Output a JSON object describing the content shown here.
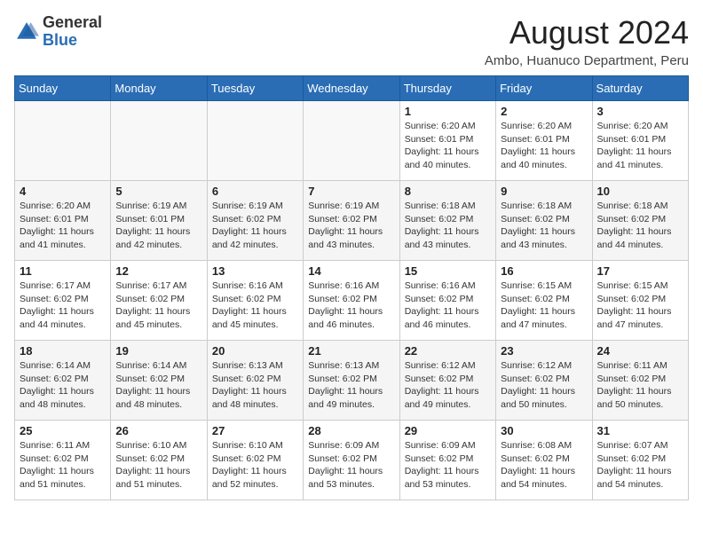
{
  "header": {
    "logo_general": "General",
    "logo_blue": "Blue",
    "month_title": "August 2024",
    "location": "Ambo, Huanuco Department, Peru"
  },
  "weekdays": [
    "Sunday",
    "Monday",
    "Tuesday",
    "Wednesday",
    "Thursday",
    "Friday",
    "Saturday"
  ],
  "weeks": [
    [
      {
        "day": "",
        "info": ""
      },
      {
        "day": "",
        "info": ""
      },
      {
        "day": "",
        "info": ""
      },
      {
        "day": "",
        "info": ""
      },
      {
        "day": "1",
        "info": "Sunrise: 6:20 AM\nSunset: 6:01 PM\nDaylight: 11 hours\nand 40 minutes."
      },
      {
        "day": "2",
        "info": "Sunrise: 6:20 AM\nSunset: 6:01 PM\nDaylight: 11 hours\nand 40 minutes."
      },
      {
        "day": "3",
        "info": "Sunrise: 6:20 AM\nSunset: 6:01 PM\nDaylight: 11 hours\nand 41 minutes."
      }
    ],
    [
      {
        "day": "4",
        "info": "Sunrise: 6:20 AM\nSunset: 6:01 PM\nDaylight: 11 hours\nand 41 minutes."
      },
      {
        "day": "5",
        "info": "Sunrise: 6:19 AM\nSunset: 6:01 PM\nDaylight: 11 hours\nand 42 minutes."
      },
      {
        "day": "6",
        "info": "Sunrise: 6:19 AM\nSunset: 6:02 PM\nDaylight: 11 hours\nand 42 minutes."
      },
      {
        "day": "7",
        "info": "Sunrise: 6:19 AM\nSunset: 6:02 PM\nDaylight: 11 hours\nand 43 minutes."
      },
      {
        "day": "8",
        "info": "Sunrise: 6:18 AM\nSunset: 6:02 PM\nDaylight: 11 hours\nand 43 minutes."
      },
      {
        "day": "9",
        "info": "Sunrise: 6:18 AM\nSunset: 6:02 PM\nDaylight: 11 hours\nand 43 minutes."
      },
      {
        "day": "10",
        "info": "Sunrise: 6:18 AM\nSunset: 6:02 PM\nDaylight: 11 hours\nand 44 minutes."
      }
    ],
    [
      {
        "day": "11",
        "info": "Sunrise: 6:17 AM\nSunset: 6:02 PM\nDaylight: 11 hours\nand 44 minutes."
      },
      {
        "day": "12",
        "info": "Sunrise: 6:17 AM\nSunset: 6:02 PM\nDaylight: 11 hours\nand 45 minutes."
      },
      {
        "day": "13",
        "info": "Sunrise: 6:16 AM\nSunset: 6:02 PM\nDaylight: 11 hours\nand 45 minutes."
      },
      {
        "day": "14",
        "info": "Sunrise: 6:16 AM\nSunset: 6:02 PM\nDaylight: 11 hours\nand 46 minutes."
      },
      {
        "day": "15",
        "info": "Sunrise: 6:16 AM\nSunset: 6:02 PM\nDaylight: 11 hours\nand 46 minutes."
      },
      {
        "day": "16",
        "info": "Sunrise: 6:15 AM\nSunset: 6:02 PM\nDaylight: 11 hours\nand 47 minutes."
      },
      {
        "day": "17",
        "info": "Sunrise: 6:15 AM\nSunset: 6:02 PM\nDaylight: 11 hours\nand 47 minutes."
      }
    ],
    [
      {
        "day": "18",
        "info": "Sunrise: 6:14 AM\nSunset: 6:02 PM\nDaylight: 11 hours\nand 48 minutes."
      },
      {
        "day": "19",
        "info": "Sunrise: 6:14 AM\nSunset: 6:02 PM\nDaylight: 11 hours\nand 48 minutes."
      },
      {
        "day": "20",
        "info": "Sunrise: 6:13 AM\nSunset: 6:02 PM\nDaylight: 11 hours\nand 48 minutes."
      },
      {
        "day": "21",
        "info": "Sunrise: 6:13 AM\nSunset: 6:02 PM\nDaylight: 11 hours\nand 49 minutes."
      },
      {
        "day": "22",
        "info": "Sunrise: 6:12 AM\nSunset: 6:02 PM\nDaylight: 11 hours\nand 49 minutes."
      },
      {
        "day": "23",
        "info": "Sunrise: 6:12 AM\nSunset: 6:02 PM\nDaylight: 11 hours\nand 50 minutes."
      },
      {
        "day": "24",
        "info": "Sunrise: 6:11 AM\nSunset: 6:02 PM\nDaylight: 11 hours\nand 50 minutes."
      }
    ],
    [
      {
        "day": "25",
        "info": "Sunrise: 6:11 AM\nSunset: 6:02 PM\nDaylight: 11 hours\nand 51 minutes."
      },
      {
        "day": "26",
        "info": "Sunrise: 6:10 AM\nSunset: 6:02 PM\nDaylight: 11 hours\nand 51 minutes."
      },
      {
        "day": "27",
        "info": "Sunrise: 6:10 AM\nSunset: 6:02 PM\nDaylight: 11 hours\nand 52 minutes."
      },
      {
        "day": "28",
        "info": "Sunrise: 6:09 AM\nSunset: 6:02 PM\nDaylight: 11 hours\nand 53 minutes."
      },
      {
        "day": "29",
        "info": "Sunrise: 6:09 AM\nSunset: 6:02 PM\nDaylight: 11 hours\nand 53 minutes."
      },
      {
        "day": "30",
        "info": "Sunrise: 6:08 AM\nSunset: 6:02 PM\nDaylight: 11 hours\nand 54 minutes."
      },
      {
        "day": "31",
        "info": "Sunrise: 6:07 AM\nSunset: 6:02 PM\nDaylight: 11 hours\nand 54 minutes."
      }
    ]
  ]
}
